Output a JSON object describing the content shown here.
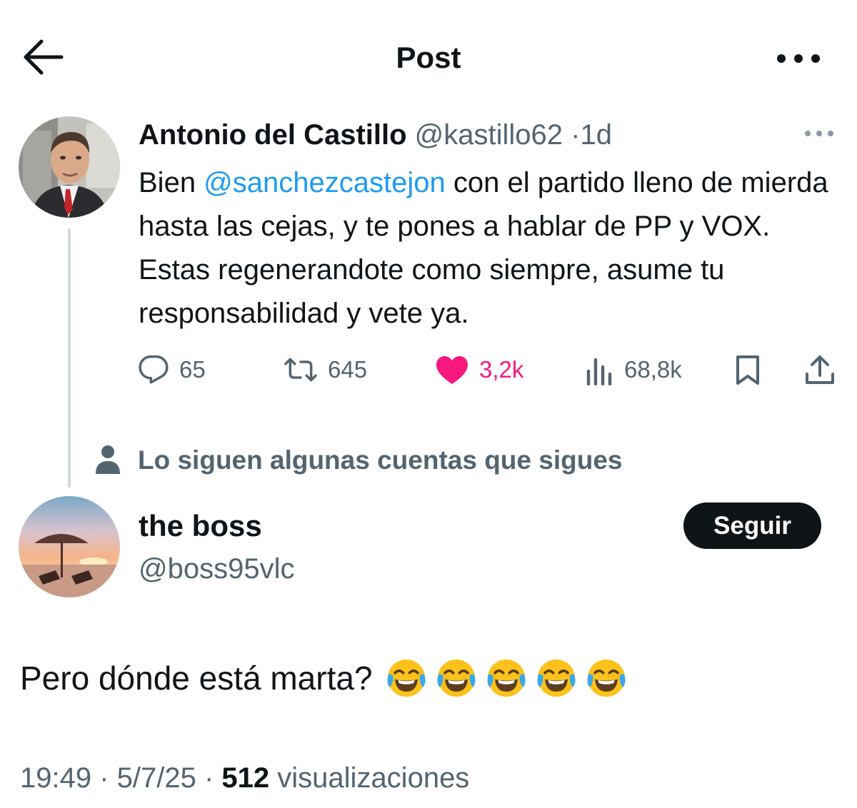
{
  "header": {
    "title": "Post",
    "back_icon": "arrow-left-icon",
    "more_icon": "more-horizontal-icon"
  },
  "parent_tweet": {
    "author_name": "Antonio del Castillo",
    "handle": "@kastillo62",
    "separator": "·",
    "time": "1d",
    "text_before_mention": "Bien ",
    "mention": "@sanchezcastejon",
    "text_after_mention": " con el partido lleno de mierda hasta las cejas, y te pones a hablar de PP y VOX. Estas regenerandote como siempre, asume tu responsabilidad y vete ya.",
    "actions": {
      "replies": "65",
      "reposts": "645",
      "likes": "3,2k",
      "views": "68,8k"
    }
  },
  "social_context": {
    "text": "Lo siguen algunas cuentas que sigues"
  },
  "reply": {
    "author_name": "the boss",
    "handle": "@boss95vlc",
    "follow_label": "Seguir",
    "text": "Pero dónde está marta?",
    "emoji_count": 5,
    "emoji_name": "face-with-tears-of-joy"
  },
  "meta": {
    "time": "19:49",
    "sep1": " · ",
    "date": "5/7/25",
    "sep2": " · ",
    "views_count": "512",
    "views_label": " visualizaciones"
  },
  "colors": {
    "text": "#0f1419",
    "secondary": "#536471",
    "link": "#1d9bf0",
    "like": "#f91880",
    "button": "#0f1419"
  }
}
